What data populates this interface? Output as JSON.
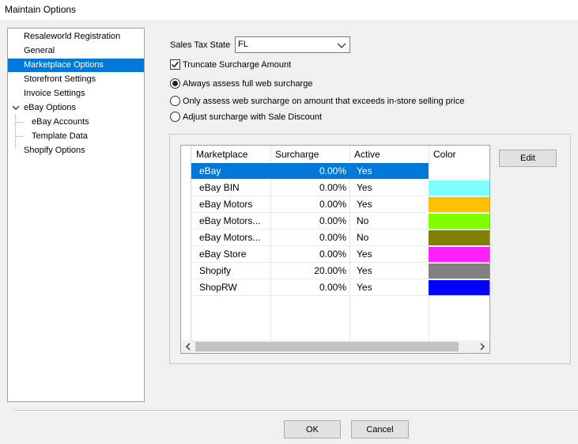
{
  "window": {
    "title": "Maintain Options"
  },
  "tree": {
    "items": [
      {
        "label": "Resaleworld Registration"
      },
      {
        "label": "General"
      },
      {
        "label": "Marketplace Options"
      },
      {
        "label": "Storefront Settings"
      },
      {
        "label": "Invoice Settings"
      },
      {
        "label": "eBay Options"
      },
      {
        "label": "eBay Accounts"
      },
      {
        "label": "Template Data"
      },
      {
        "label": "Shopify Options"
      }
    ],
    "selected": "Marketplace Options"
  },
  "settings": {
    "sales_tax_state_label": "Sales Tax State",
    "sales_tax_state_value": "FL",
    "truncate_label": "Truncate Surcharge Amount",
    "truncate_checked": true,
    "radio_always": "Always assess full web surcharge",
    "radio_exceeds": "Only assess web surcharge on amount that exceeds in-store selling price",
    "radio_discount": "Adjust surcharge with Sale Discount",
    "selected_radio": "always"
  },
  "grid": {
    "columns": [
      "Marketplace",
      "Surcharge",
      "Active",
      "Color"
    ],
    "rows": [
      {
        "marketplace": "eBay",
        "surcharge": "0.00%",
        "active": "Yes",
        "color": "#ffffff"
      },
      {
        "marketplace": "eBay BIN",
        "surcharge": "0.00%",
        "active": "Yes",
        "color": "#80ffff"
      },
      {
        "marketplace": "eBay Motors",
        "surcharge": "0.00%",
        "active": "Yes",
        "color": "#ffc000"
      },
      {
        "marketplace": "eBay Motors...",
        "surcharge": "0.00%",
        "active": "No",
        "color": "#80ff00"
      },
      {
        "marketplace": "eBay Motors...",
        "surcharge": "0.00%",
        "active": "No",
        "color": "#808000"
      },
      {
        "marketplace": "eBay Store",
        "surcharge": "0.00%",
        "active": "Yes",
        "color": "#ff20ff"
      },
      {
        "marketplace": "Shopify",
        "surcharge": "20.00%",
        "active": "Yes",
        "color": "#808080"
      },
      {
        "marketplace": "ShopRW",
        "surcharge": "0.00%",
        "active": "Yes",
        "color": "#0000ff"
      }
    ],
    "selected_row": "eBay"
  },
  "buttons": {
    "edit": "Edit",
    "ok": "OK",
    "cancel": "Cancel"
  },
  "colors": {
    "selection": "#0078d7"
  }
}
